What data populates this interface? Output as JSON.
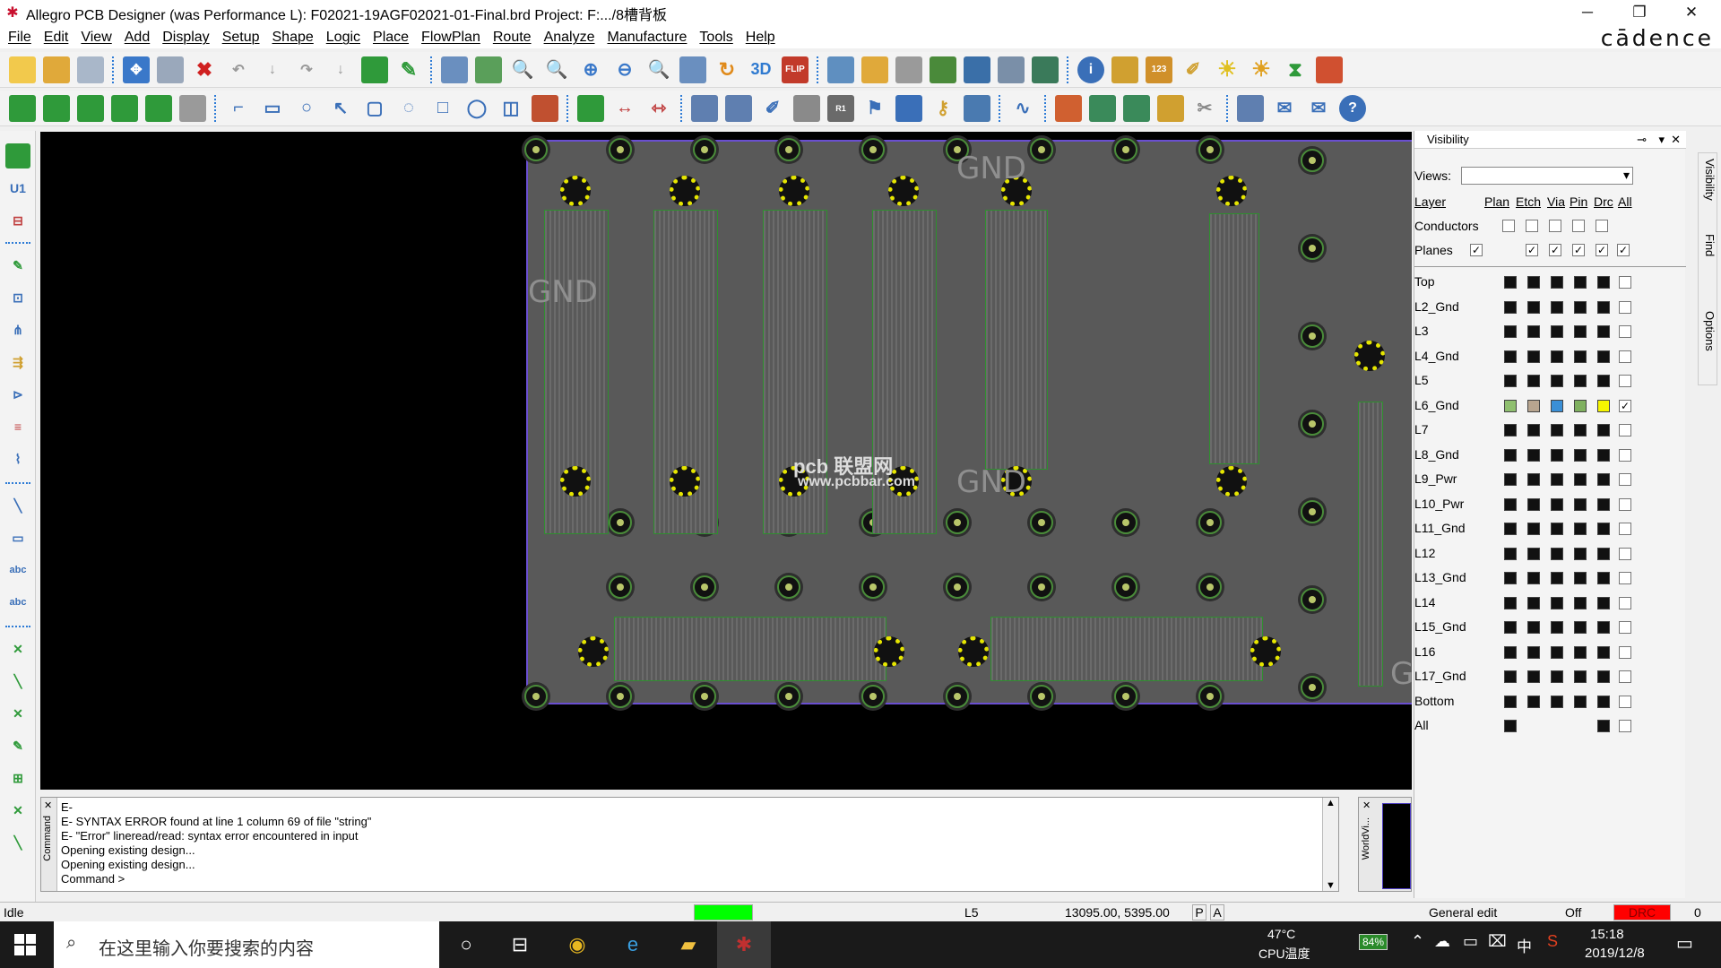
{
  "window": {
    "title": "Allegro PCB Designer (was Performance L): F02021-19AGF02021-01-Final.brd  Project: F:.../8槽背板",
    "minimize": "─",
    "restore": "❐",
    "close": "✕",
    "brand": "cādence"
  },
  "menu": [
    "File",
    "Edit",
    "View",
    "Add",
    "Display",
    "Setup",
    "Shape",
    "Logic",
    "Place",
    "FlowPlan",
    "Route",
    "Analyze",
    "Manufacture",
    "Tools",
    "Help"
  ],
  "board": {
    "labels": [
      "GND",
      "GND",
      "GND",
      "GND"
    ],
    "watermark": "pcb 联盟网",
    "watermark_url": "www.pcbbar.com"
  },
  "command": {
    "side_label": "Command",
    "lines": "E-\nE- SYNTAX ERROR found at line 1 column 69 of file \"string\"\nE- \"Error\" lineread/read: syntax error encountered in input\nOpening existing design...\nOpening existing design...\nCommand >"
  },
  "worldview": {
    "label": "WorldVi..."
  },
  "visibility": {
    "title": "Visibility",
    "views_label": "Views:",
    "columns": [
      "Layer",
      "Plan",
      "Etch",
      "Via",
      "Pin",
      "Drc",
      "All"
    ],
    "conductors": "Conductors",
    "planes": "Planes",
    "layers": [
      "Top",
      "L2_Gnd",
      "L3",
      "L4_Gnd",
      "L5",
      "L6_Gnd",
      "L7",
      "L8_Gnd",
      "L9_Pwr",
      "L10_Pwr",
      "L11_Gnd",
      "L12",
      "L13_Gnd",
      "L14",
      "L15_Gnd",
      "L16",
      "L17_Gnd",
      "Bottom",
      "All"
    ],
    "highlight_colors": [
      "#8fbf6f",
      "#b8a58f",
      "#3a8fd6",
      "#7fb05f",
      "#f5f500"
    ],
    "tabs": [
      "Visibility",
      "Find",
      "Options"
    ]
  },
  "status": {
    "mode": "Idle",
    "layer": "L5",
    "coords": "13095.00, 5395.00",
    "p": "P",
    "a": "A",
    "edit_mode": "General edit",
    "off": "Off",
    "drc": "DRC",
    "count": "0",
    "green": "#00ff00",
    "red": "#ff0000"
  },
  "taskbar": {
    "search_placeholder": "在这里输入你要搜索的内容",
    "temp": "47°C",
    "temp_label": "CPU温度",
    "battery": "84%",
    "ime": "中",
    "time": "15:18",
    "date": "2019/12/8"
  }
}
